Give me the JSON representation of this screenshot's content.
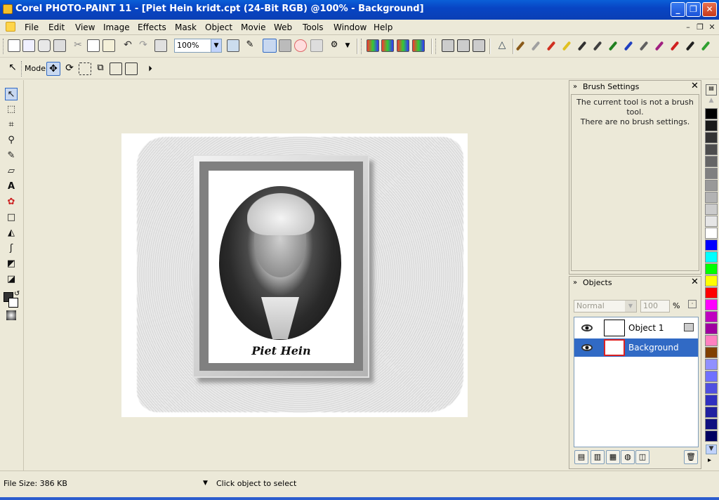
{
  "window": {
    "title": "Corel PHOTO-PAINT 11 - [Piet Hein kridt.cpt (24-Bit RGB) @100% - Background]",
    "minimize": "_",
    "restore": "❐",
    "close": "✕"
  },
  "menubar": {
    "items": [
      "File",
      "Edit",
      "View",
      "Image",
      "Effects",
      "Mask",
      "Object",
      "Movie",
      "Web",
      "Tools",
      "Window",
      "Help"
    ],
    "mdi_min": "–",
    "mdi_restore": "❐",
    "mdi_close": "✕"
  },
  "toolbar": {
    "zoom_value": "100%",
    "zoom_arrow": "▼",
    "pen_colors": [
      "#8a5a1a",
      "#a0a0a0",
      "#d03020",
      "#e0c020",
      "#303030",
      "#404040",
      "#208020",
      "#2040c0",
      "#606060",
      "#a02080",
      "#d02020",
      "#202020",
      "#30a030"
    ]
  },
  "propertybar": {
    "mode_label": "Mode"
  },
  "toolbox": {
    "tools": [
      "pointer",
      "mask-rectangle",
      "crop",
      "zoom",
      "eyedropper",
      "eraser",
      "text",
      "paint",
      "rectangle",
      "fill",
      "effect",
      "shadow",
      "transparency"
    ]
  },
  "document": {
    "caption": "Piet Hein"
  },
  "brush_panel": {
    "title": "Brush Settings",
    "close": "✕",
    "message_line1": "The current tool is not a brush tool.",
    "message_line2": "There are no brush settings."
  },
  "objects_panel": {
    "title": "Objects",
    "close": "✕",
    "blend_mode": "Normal",
    "opacity": "100",
    "percent": "%",
    "objects": [
      {
        "name": "Object 1",
        "selected": false
      },
      {
        "name": "Background",
        "selected": true
      }
    ],
    "delete_icon": "🗑"
  },
  "palette": {
    "colors": [
      "#000000",
      "#1a1a1a",
      "#333333",
      "#4d4d4d",
      "#666666",
      "#808080",
      "#999999",
      "#b3b3b3",
      "#cccccc",
      "#e6e6e6",
      "#ffffff",
      "#0000ff",
      "#00ffff",
      "#00ff00",
      "#ffff00",
      "#ff0000",
      "#ff00ff",
      "#c000c0",
      "#a000a0",
      "#ff80c0",
      "#804000",
      "#9090ff",
      "#7070ff",
      "#5050e0",
      "#3030c0",
      "#2020a0",
      "#101080",
      "#000060"
    ]
  },
  "statusbar": {
    "file_size": "File Size: 386 KB",
    "arrow": "▼",
    "hint": "Click object to select"
  }
}
